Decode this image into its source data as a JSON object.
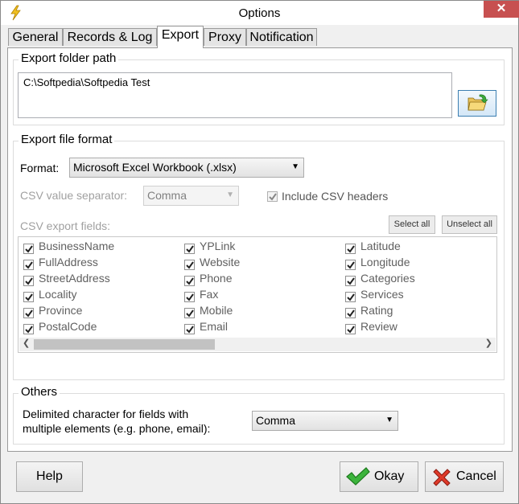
{
  "window": {
    "title": "Options"
  },
  "tabs": [
    {
      "label": "General"
    },
    {
      "label": "Records & Log"
    },
    {
      "label": "Export"
    },
    {
      "label": "Proxy"
    },
    {
      "label": "Notification"
    }
  ],
  "export_folder": {
    "group_title": "Export folder path",
    "path_value": "C:\\Softpedia\\Softpedia Test"
  },
  "export_format": {
    "group_title": "Export file format",
    "format_label": "Format:",
    "format_value": "Microsoft Excel Workbook (.xlsx)",
    "csv_separator_label": "CSV value separator:",
    "csv_separator_value": "Comma",
    "include_headers_label": "Include CSV headers",
    "include_headers_checked": true,
    "csv_fields_label": "CSV export fields:",
    "select_all_label": "Select all",
    "unselect_all_label": "Unselect all",
    "fields": [
      [
        "BusinessName",
        "YPLink",
        "Latitude"
      ],
      [
        "FullAddress",
        "Website",
        "Longitude"
      ],
      [
        "StreetAddress",
        "Phone",
        "Categories"
      ],
      [
        "Locality",
        "Fax",
        "Services"
      ],
      [
        "Province",
        "Mobile",
        "Rating"
      ],
      [
        "PostalCode",
        "Email",
        "Review"
      ]
    ]
  },
  "others": {
    "group_title": "Others",
    "delimiter_label_line1": "Delimited character for fields with",
    "delimiter_label_line2": "multiple elements (e.g. phone, email):",
    "delimiter_value": "Comma"
  },
  "buttons": {
    "help": "Help",
    "okay": "Okay",
    "cancel": "Cancel"
  }
}
